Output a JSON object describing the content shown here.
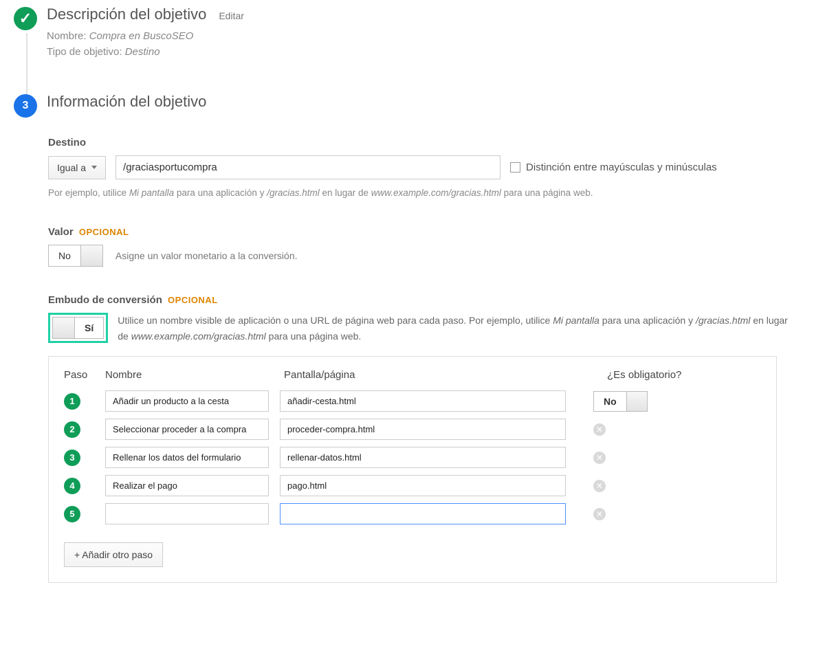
{
  "step1": {
    "title": "Descripción del objetivo",
    "edit": "Editar",
    "name_label": "Nombre:",
    "name_value": "Compra en BuscoSEO",
    "type_label": "Tipo de objetivo:",
    "type_value": "Destino"
  },
  "step2": {
    "badge": "3",
    "title": "Información del objetivo"
  },
  "destino": {
    "label": "Destino",
    "match_type": "Igual a",
    "url": "/graciasportucompra",
    "case_label": "Distinción entre mayúsculas y minúsculas",
    "hint_prefix": "Por ejemplo, utilice ",
    "hint_app": "Mi pantalla",
    "hint_mid1": " para una aplicación y ",
    "hint_url1": "/gracias.html",
    "hint_mid2": " en lugar de ",
    "hint_url2": "www.example.com/gracias.html",
    "hint_suffix": " para una página web."
  },
  "valor": {
    "label": "Valor",
    "optional": "OPCIONAL",
    "toggle": "No",
    "text": "Asigne un valor monetario a la conversión."
  },
  "embudo": {
    "label": "Embudo de conversión",
    "optional": "OPCIONAL",
    "toggle": "Sí",
    "text_prefix": "Utilice un nombre visible de aplicación o una URL de página web para cada paso. Por ejemplo, utilice ",
    "text_app": "Mi pantalla",
    "text_mid1": " para una aplicación y ",
    "text_url1": "/gracias.html",
    "text_mid2": " en lugar de ",
    "text_url2": "www.example.com/gracias.html",
    "text_suffix": " para una página web."
  },
  "funnel": {
    "col_paso": "Paso",
    "col_nombre": "Nombre",
    "col_pantalla": "Pantalla/página",
    "col_oblig": "¿Es obligatorio?",
    "oblig_toggle": "No",
    "steps": [
      {
        "num": "1",
        "name": "Añadir un producto a la cesta",
        "url": "añadir-cesta.html"
      },
      {
        "num": "2",
        "name": "Seleccionar proceder a la compra",
        "url": "proceder-compra.html"
      },
      {
        "num": "3",
        "name": "Rellenar los datos del formulario",
        "url": "rellenar-datos.html"
      },
      {
        "num": "4",
        "name": "Realizar el pago",
        "url": "pago.html"
      },
      {
        "num": "5",
        "name": "",
        "url": ""
      }
    ],
    "add_button": "+ Añadir otro paso"
  }
}
